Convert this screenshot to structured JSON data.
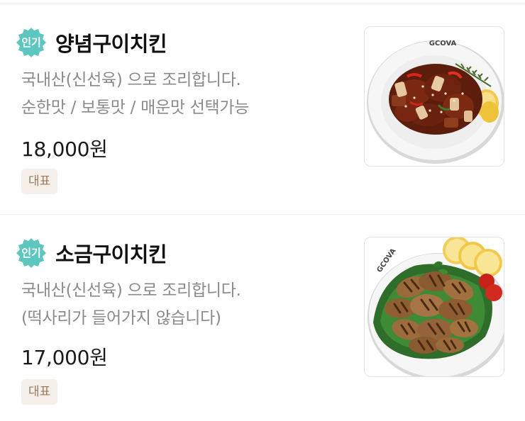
{
  "menu": {
    "items": [
      {
        "badge": "인기",
        "name": "양념구이치킨",
        "desc_lines": [
          "국내산(신선육) 으로 조리합니다.",
          "순한맛 / 보통맛 / 매운맛 선택가능"
        ],
        "price": "18,000원",
        "tag": "대표",
        "image": {
          "plate_text": "GCOVA",
          "icon": "spicy-grilled-chicken-photo"
        }
      },
      {
        "badge": "인기",
        "name": "소금구이치킨",
        "desc_lines": [
          "국내산(신선육) 으로 조리합니다.",
          "(떡사리가 들어가지 않습니다)"
        ],
        "price": "17,000원",
        "tag": "대표",
        "image": {
          "plate_text": "GCOVA",
          "icon": "salt-grilled-chicken-photo"
        }
      }
    ]
  },
  "colors": {
    "badge_bg": "#5cc6bf",
    "tag_text": "#9a7b5e",
    "tag_bg": "#f4efe9",
    "desc_text": "#8a8a8a"
  }
}
